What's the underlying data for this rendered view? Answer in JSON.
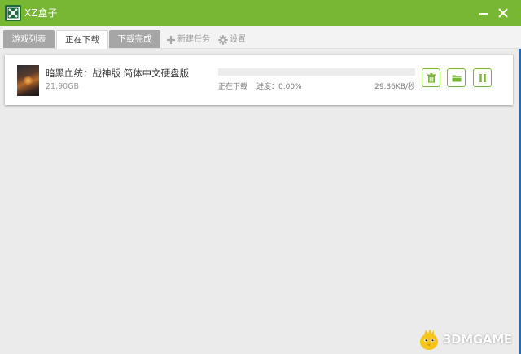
{
  "window": {
    "title": "XZ盒子",
    "accent_color": "#78b733",
    "minimize_icon": "minimize-icon",
    "close_icon": "close-icon"
  },
  "tabs": [
    {
      "label": "游戏列表",
      "active": false
    },
    {
      "label": "正在下载",
      "active": true
    },
    {
      "label": "下载完成",
      "active": false
    }
  ],
  "toolbar": {
    "new_task_label": "新建任务",
    "new_task_icon": "plus-icon",
    "settings_label": "设置",
    "settings_icon": "gear-icon"
  },
  "downloads": [
    {
      "title": "暗黑血统：战神版 简体中文硬盘版",
      "size": "21.90GB",
      "status": "正在下载",
      "progress_text": "进度：0.00%",
      "progress_fraction": 0.0,
      "speed": "29.36KB/秒",
      "actions": [
        {
          "icon": "trash-icon"
        },
        {
          "icon": "folder-icon"
        },
        {
          "icon": "pause-icon"
        }
      ]
    }
  ],
  "watermark": {
    "text": "3DMGAME"
  }
}
